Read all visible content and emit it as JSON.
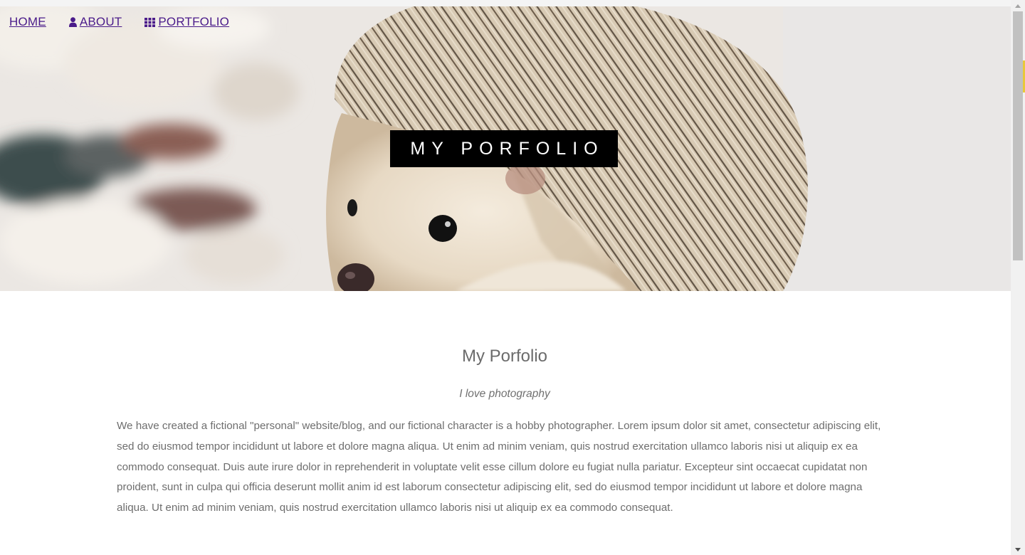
{
  "nav": {
    "home": "HOME",
    "about": "ABOUT",
    "portfolio": "PORTFOLIO"
  },
  "hero": {
    "title": "MY PORFOLIO"
  },
  "main": {
    "heading": "My Porfolio",
    "subtitle": "I love photography",
    "body": "We have created a fictional \"personal\" website/blog, and our fictional character is a hobby photographer. Lorem ipsum dolor sit amet, consectetur adipiscing elit, sed do eiusmod tempor incididunt ut labore et dolore magna aliqua. Ut enim ad minim veniam, quis nostrud exercitation ullamco laboris nisi ut aliquip ex ea commodo consequat. Duis aute irure dolor in reprehenderit in voluptate velit esse cillum dolore eu fugiat nulla pariatur. Excepteur sint occaecat cupidatat non proident, sunt in culpa qui officia deserunt mollit anim id est laborum consectetur adipiscing elit, sed do eiusmod tempor incididunt ut labore et dolore magna aliqua. Ut enim ad minim veniam, quis nostrud exercitation ullamco laboris nisi ut aliquip ex ea commodo consequat."
  },
  "icons": {
    "about": "user-icon",
    "portfolio": "grid-icon"
  },
  "colors": {
    "link": "#4a1b8a",
    "title_bg": "#000000",
    "title_text": "#ffffff",
    "text": "#6e6e6e"
  }
}
